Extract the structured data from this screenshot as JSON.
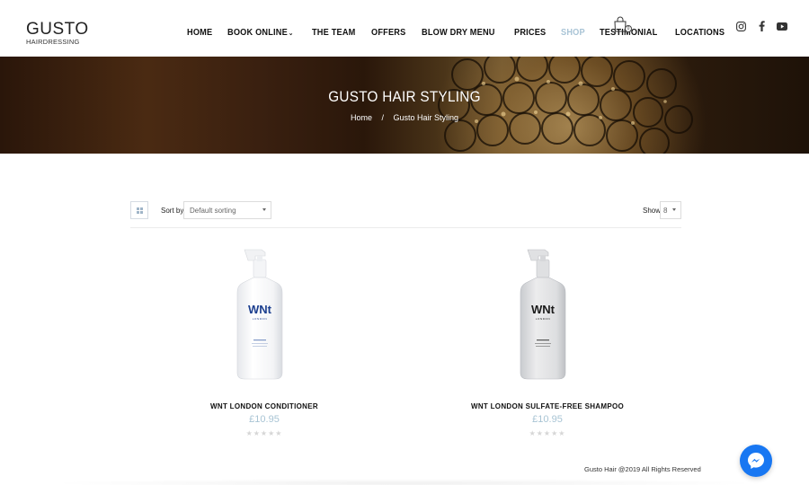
{
  "brand": {
    "logo_main": "GUSTO",
    "logo_sub": "HAIRDRESSING"
  },
  "nav": {
    "items": [
      {
        "label": "HOME"
      },
      {
        "label": "BOOK ONLINE",
        "has_dropdown": true
      },
      {
        "label": "THE TEAM"
      },
      {
        "label": "OFFERS"
      },
      {
        "label": "BLOW DRY MENU"
      },
      {
        "label": "PRICES"
      },
      {
        "label": "SHOP",
        "active": true
      },
      {
        "label": "TESTIMONIAL"
      },
      {
        "label": "LOCATIONS"
      }
    ],
    "cart_count": "0",
    "social_icons": [
      "instagram-icon",
      "facebook-icon",
      "youtube-icon"
    ]
  },
  "hero": {
    "title": "GUSTO HAIR STYLING",
    "breadcrumb": {
      "home": "Home",
      "separator": "/",
      "current": "Gusto Hair Styling"
    }
  },
  "toolbar": {
    "sort_label": "Sort by",
    "sort_value": "Default sorting",
    "show_label": "Show",
    "show_value": "8"
  },
  "products": [
    {
      "name": "WNT LONDON CONDITIONER",
      "price": "£10.95",
      "rating": "★★★★★",
      "bottle_brand": "WNt",
      "bottle_sub": "LONDON",
      "brand_color": "#1c3f8f"
    },
    {
      "name": "WNT LONDON SULFATE-FREE SHAMPOO",
      "price": "£10.95",
      "rating": "★★★★★",
      "bottle_brand": "WNt",
      "bottle_sub": "LONDON",
      "brand_color": "#1a1a1a"
    }
  ],
  "footer": {
    "copyright": "Gusto Hair @2019 All Rights Reserved"
  },
  "colors": {
    "accent": "#a8c4d4",
    "messenger": "#1877f2"
  }
}
